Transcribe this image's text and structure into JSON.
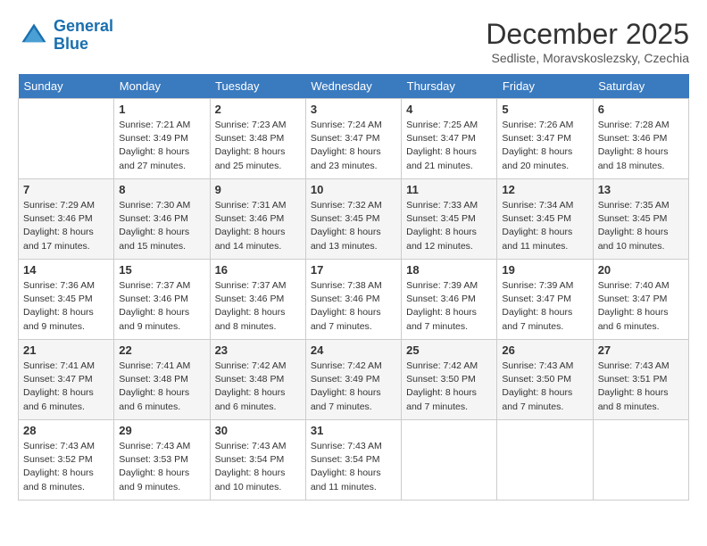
{
  "header": {
    "logo_line1": "General",
    "logo_line2": "Blue",
    "month_title": "December 2025",
    "location": "Sedliste, Moravskoslezsky, Czechia"
  },
  "weekdays": [
    "Sunday",
    "Monday",
    "Tuesday",
    "Wednesday",
    "Thursday",
    "Friday",
    "Saturday"
  ],
  "weeks": [
    [
      {
        "day": "",
        "empty": true
      },
      {
        "day": "1",
        "sunrise": "7:21 AM",
        "sunset": "3:49 PM",
        "daylight": "8 hours and 27 minutes."
      },
      {
        "day": "2",
        "sunrise": "7:23 AM",
        "sunset": "3:48 PM",
        "daylight": "8 hours and 25 minutes."
      },
      {
        "day": "3",
        "sunrise": "7:24 AM",
        "sunset": "3:47 PM",
        "daylight": "8 hours and 23 minutes."
      },
      {
        "day": "4",
        "sunrise": "7:25 AM",
        "sunset": "3:47 PM",
        "daylight": "8 hours and 21 minutes."
      },
      {
        "day": "5",
        "sunrise": "7:26 AM",
        "sunset": "3:47 PM",
        "daylight": "8 hours and 20 minutes."
      },
      {
        "day": "6",
        "sunrise": "7:28 AM",
        "sunset": "3:46 PM",
        "daylight": "8 hours and 18 minutes."
      }
    ],
    [
      {
        "day": "7",
        "sunrise": "7:29 AM",
        "sunset": "3:46 PM",
        "daylight": "8 hours and 17 minutes."
      },
      {
        "day": "8",
        "sunrise": "7:30 AM",
        "sunset": "3:46 PM",
        "daylight": "8 hours and 15 minutes."
      },
      {
        "day": "9",
        "sunrise": "7:31 AM",
        "sunset": "3:46 PM",
        "daylight": "8 hours and 14 minutes."
      },
      {
        "day": "10",
        "sunrise": "7:32 AM",
        "sunset": "3:45 PM",
        "daylight": "8 hours and 13 minutes."
      },
      {
        "day": "11",
        "sunrise": "7:33 AM",
        "sunset": "3:45 PM",
        "daylight": "8 hours and 12 minutes."
      },
      {
        "day": "12",
        "sunrise": "7:34 AM",
        "sunset": "3:45 PM",
        "daylight": "8 hours and 11 minutes."
      },
      {
        "day": "13",
        "sunrise": "7:35 AM",
        "sunset": "3:45 PM",
        "daylight": "8 hours and 10 minutes."
      }
    ],
    [
      {
        "day": "14",
        "sunrise": "7:36 AM",
        "sunset": "3:45 PM",
        "daylight": "8 hours and 9 minutes."
      },
      {
        "day": "15",
        "sunrise": "7:37 AM",
        "sunset": "3:46 PM",
        "daylight": "8 hours and 9 minutes."
      },
      {
        "day": "16",
        "sunrise": "7:37 AM",
        "sunset": "3:46 PM",
        "daylight": "8 hours and 8 minutes."
      },
      {
        "day": "17",
        "sunrise": "7:38 AM",
        "sunset": "3:46 PM",
        "daylight": "8 hours and 7 minutes."
      },
      {
        "day": "18",
        "sunrise": "7:39 AM",
        "sunset": "3:46 PM",
        "daylight": "8 hours and 7 minutes."
      },
      {
        "day": "19",
        "sunrise": "7:39 AM",
        "sunset": "3:47 PM",
        "daylight": "8 hours and 7 minutes."
      },
      {
        "day": "20",
        "sunrise": "7:40 AM",
        "sunset": "3:47 PM",
        "daylight": "8 hours and 6 minutes."
      }
    ],
    [
      {
        "day": "21",
        "sunrise": "7:41 AM",
        "sunset": "3:47 PM",
        "daylight": "8 hours and 6 minutes."
      },
      {
        "day": "22",
        "sunrise": "7:41 AM",
        "sunset": "3:48 PM",
        "daylight": "8 hours and 6 minutes."
      },
      {
        "day": "23",
        "sunrise": "7:42 AM",
        "sunset": "3:48 PM",
        "daylight": "8 hours and 6 minutes."
      },
      {
        "day": "24",
        "sunrise": "7:42 AM",
        "sunset": "3:49 PM",
        "daylight": "8 hours and 7 minutes."
      },
      {
        "day": "25",
        "sunrise": "7:42 AM",
        "sunset": "3:50 PM",
        "daylight": "8 hours and 7 minutes."
      },
      {
        "day": "26",
        "sunrise": "7:43 AM",
        "sunset": "3:50 PM",
        "daylight": "8 hours and 7 minutes."
      },
      {
        "day": "27",
        "sunrise": "7:43 AM",
        "sunset": "3:51 PM",
        "daylight": "8 hours and 8 minutes."
      }
    ],
    [
      {
        "day": "28",
        "sunrise": "7:43 AM",
        "sunset": "3:52 PM",
        "daylight": "8 hours and 8 minutes."
      },
      {
        "day": "29",
        "sunrise": "7:43 AM",
        "sunset": "3:53 PM",
        "daylight": "8 hours and 9 minutes."
      },
      {
        "day": "30",
        "sunrise": "7:43 AM",
        "sunset": "3:54 PM",
        "daylight": "8 hours and 10 minutes."
      },
      {
        "day": "31",
        "sunrise": "7:43 AM",
        "sunset": "3:54 PM",
        "daylight": "8 hours and 11 minutes."
      },
      {
        "day": "",
        "empty": true
      },
      {
        "day": "",
        "empty": true
      },
      {
        "day": "",
        "empty": true
      }
    ]
  ]
}
